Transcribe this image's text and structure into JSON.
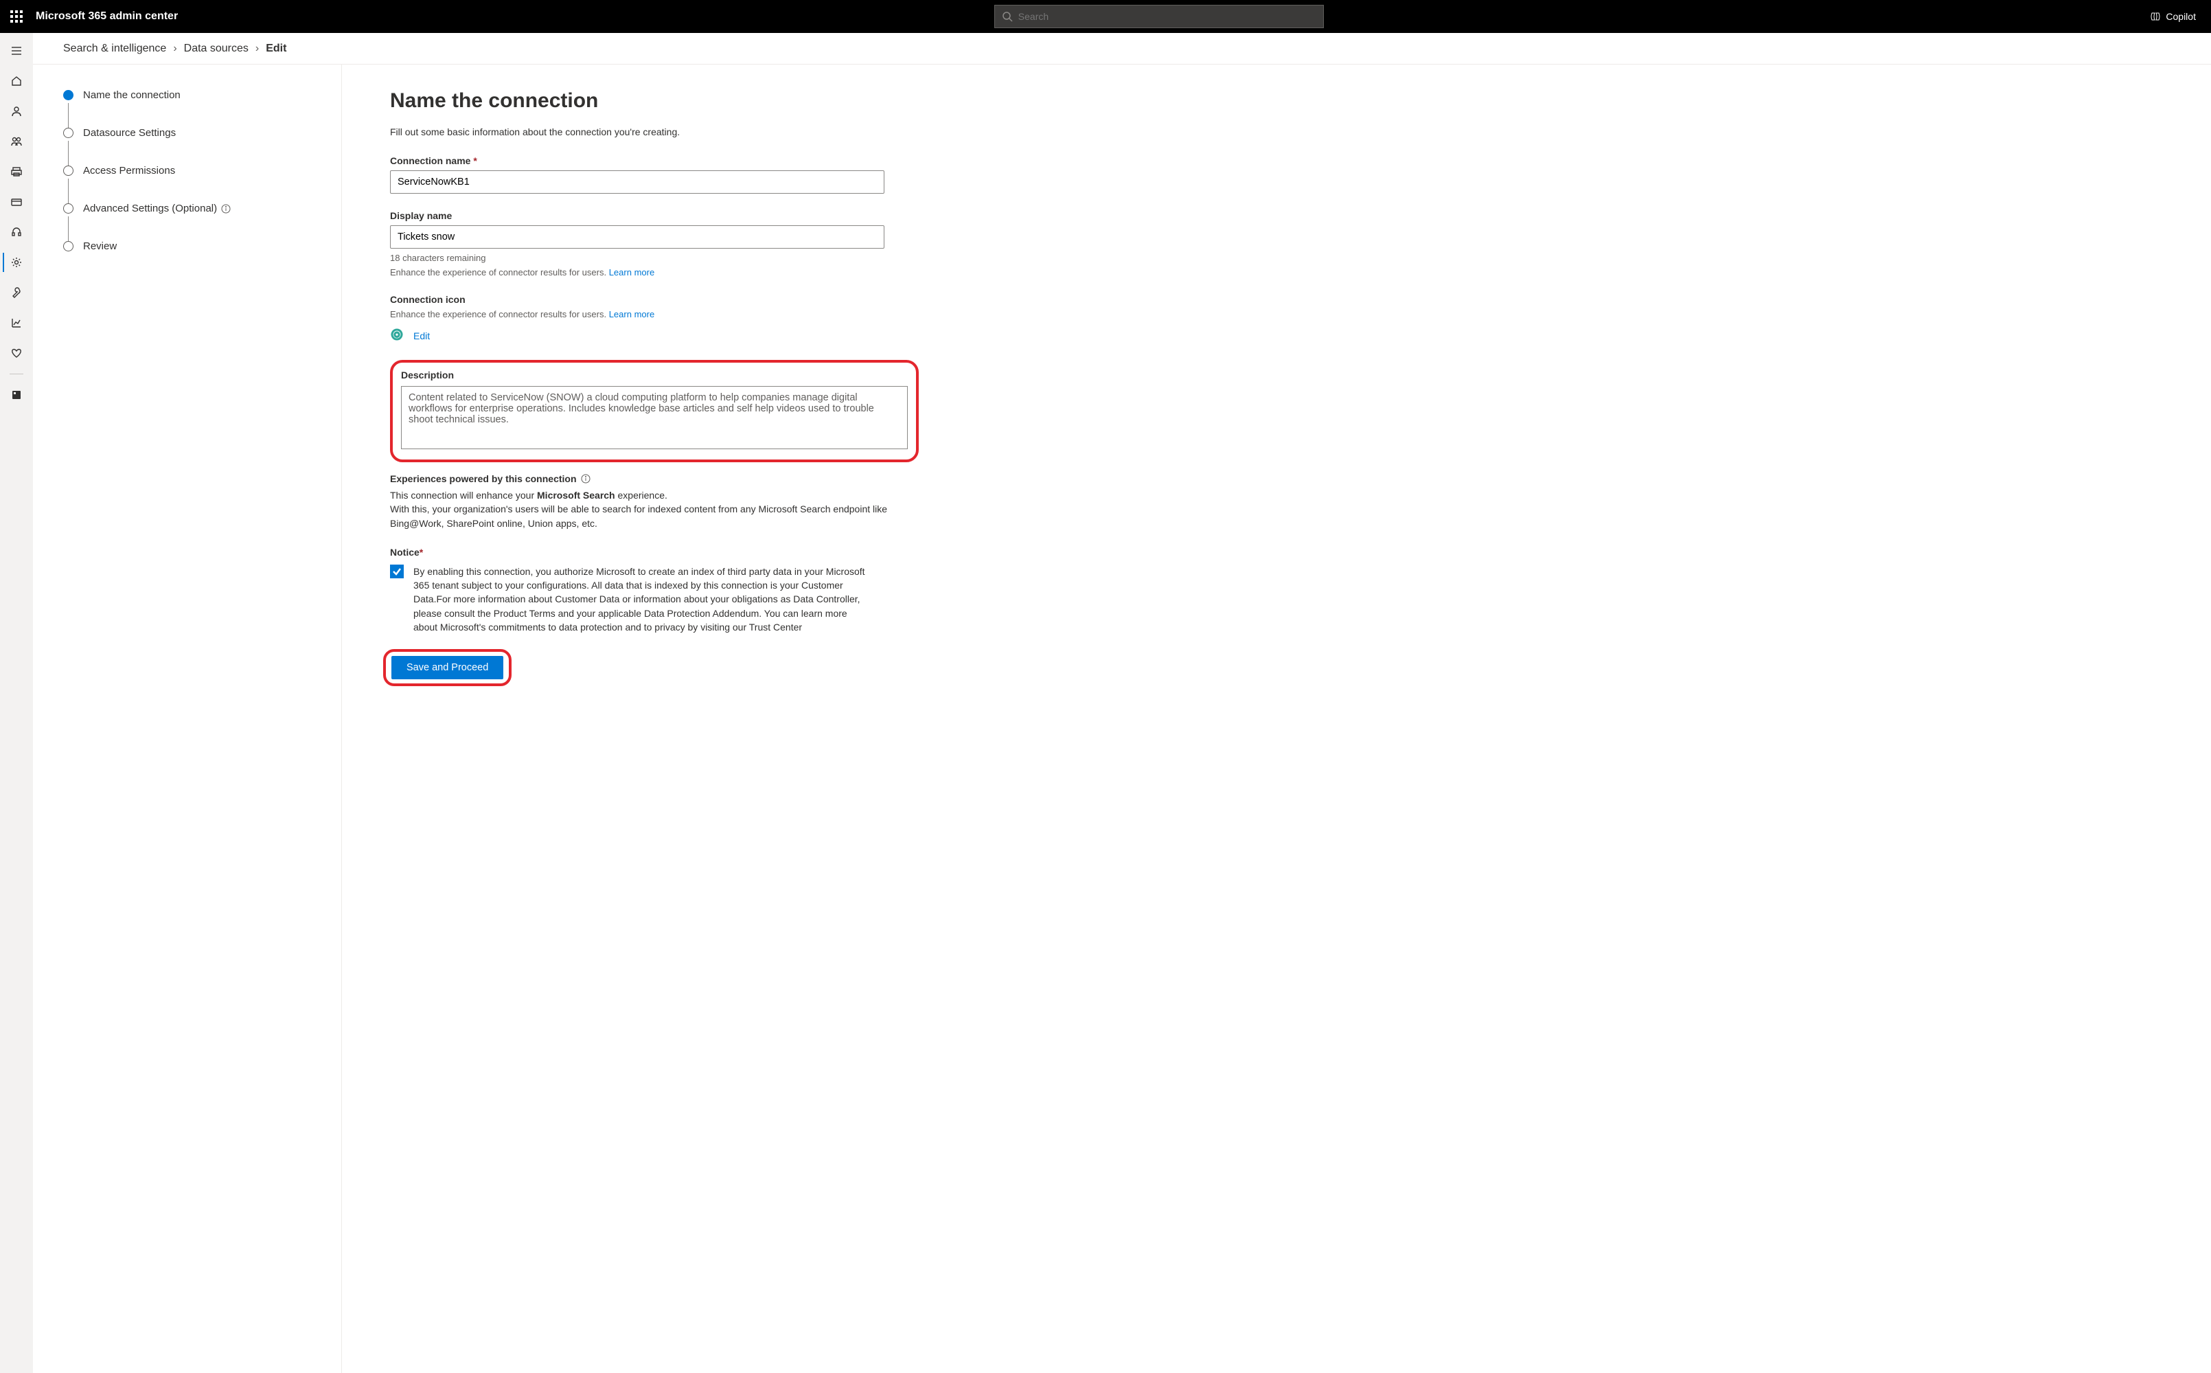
{
  "header": {
    "title": "Microsoft 365 admin center",
    "search_placeholder": "Search",
    "copilot_label": "Copilot"
  },
  "breadcrumb": {
    "lvl1": "Search & intelligence",
    "lvl2": "Data sources",
    "current": "Edit"
  },
  "steps": {
    "s1": "Name the connection",
    "s2": "Datasource Settings",
    "s3": "Access Permissions",
    "s4": "Advanced Settings (Optional)",
    "s5": "Review"
  },
  "form": {
    "heading": "Name the connection",
    "subtitle": "Fill out some basic information about the connection you're creating.",
    "connection_name_label": "Connection name",
    "connection_name_value": "ServiceNowKB1",
    "display_name_label": "Display name",
    "display_name_value": "Tickets snow",
    "display_name_remaining": "18 characters remaining",
    "display_name_help": "Enhance the experience of connector results for users.",
    "learn_more": "Learn more",
    "icon_label": "Connection icon",
    "icon_help": "Enhance the experience of connector results for users.",
    "icon_edit": "Edit",
    "description_label": "Description",
    "description_value": "Content related to ServiceNow (SNOW) a cloud computing platform to help companies manage digital workflows for enterprise operations. Includes knowledge base articles and self help videos used to trouble shoot technical issues.",
    "experiences_label": "Experiences powered by this connection",
    "experiences_line1a": "This connection will enhance your ",
    "experiences_line1b": "Microsoft Search",
    "experiences_line1c": " experience.",
    "experiences_line2": "With this, your organization's users will be able to search for indexed content from any Microsoft Search endpoint like Bing@Work, SharePoint online, Union apps, etc.",
    "notice_label": "Notice",
    "notice_text": "By enabling this connection, you authorize Microsoft to create an index of third party data in your Microsoft 365 tenant subject to your configurations. All data that is indexed by this connection is your Customer Data.For more information about Customer Data or information about your obligations as Data Controller, please consult the Product Terms and your applicable Data Protection Addendum. You can learn more about Microsoft's commitments to data protection and to privacy by visiting our Trust Center",
    "save_label": "Save and Proceed"
  }
}
